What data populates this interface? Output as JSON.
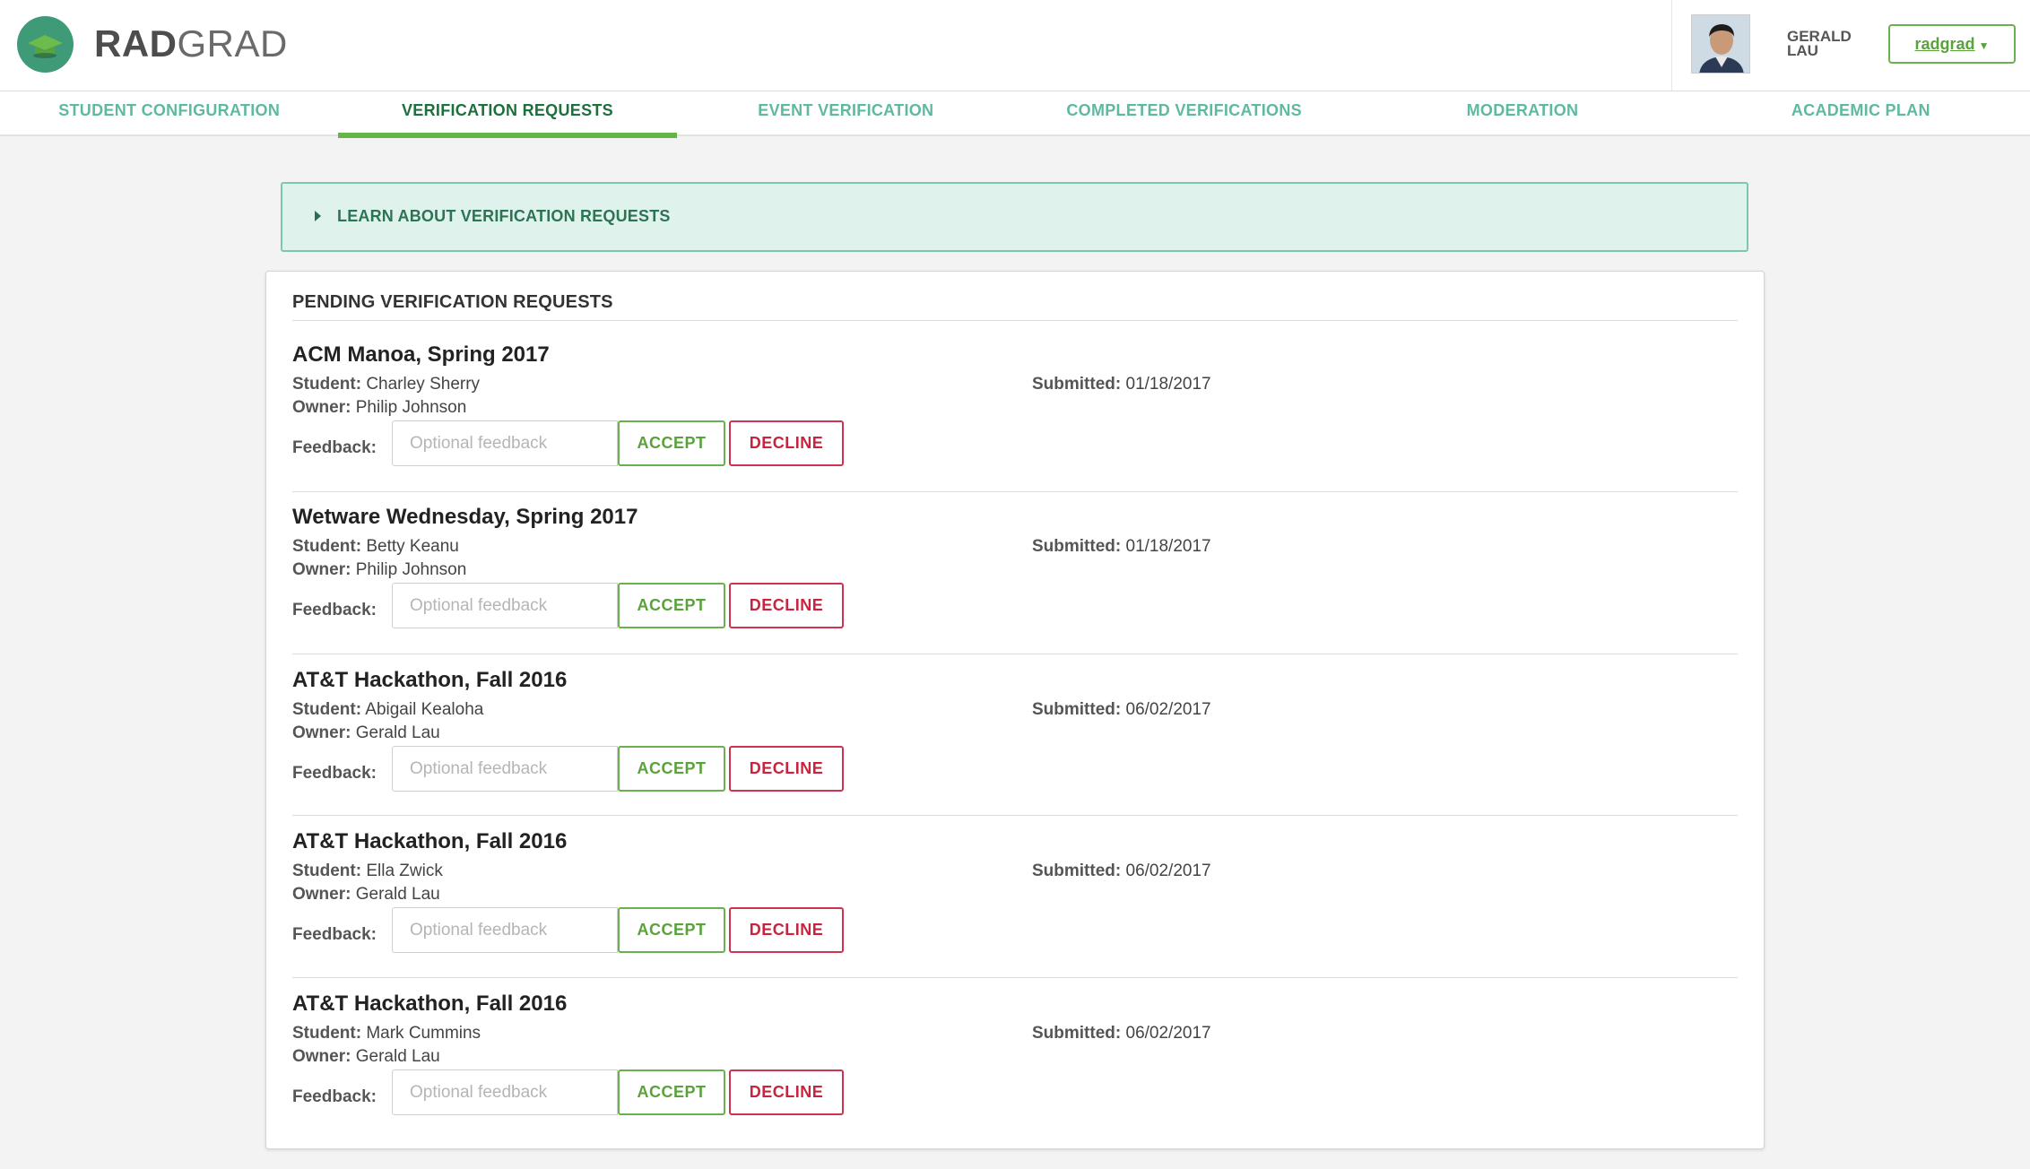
{
  "header": {
    "logo_bold": "RAD",
    "logo_light": "GRAD",
    "user_first": "GERALD",
    "user_last": "LAU",
    "user_menu_label": "radgrad"
  },
  "nav": {
    "tabs": [
      {
        "label": "STUDENT CONFIGURATION",
        "active": false
      },
      {
        "label": "VERIFICATION REQUESTS",
        "active": true
      },
      {
        "label": "EVENT VERIFICATION",
        "active": false
      },
      {
        "label": "COMPLETED VERIFICATIONS",
        "active": false
      },
      {
        "label": "MODERATION",
        "active": false
      },
      {
        "label": "ACADEMIC PLAN",
        "active": false
      }
    ]
  },
  "learn": {
    "label": "LEARN ABOUT VERIFICATION REQUESTS"
  },
  "pending": {
    "title": "PENDING VERIFICATION REQUESTS",
    "student_label": "Student:",
    "owner_label": "Owner:",
    "submitted_label": "Submitted:",
    "feedback_label": "Feedback:",
    "feedback_placeholder": "Optional feedback",
    "accept_label": "ACCEPT",
    "decline_label": "DECLINE",
    "requests": [
      {
        "title": "ACM Manoa, Spring 2017",
        "student": "Charley Sherry",
        "owner": "Philip Johnson",
        "submitted": "01/18/2017"
      },
      {
        "title": "Wetware Wednesday, Spring 2017",
        "student": "Betty Keanu",
        "owner": "Philip Johnson",
        "submitted": "01/18/2017"
      },
      {
        "title": "AT&T Hackathon, Fall 2016",
        "student": "Abigail Kealoha",
        "owner": "Gerald Lau",
        "submitted": "06/02/2017"
      },
      {
        "title": "AT&T Hackathon, Fall 2016",
        "student": "Ella Zwick",
        "owner": "Gerald Lau",
        "submitted": "06/02/2017"
      },
      {
        "title": "AT&T Hackathon, Fall 2016",
        "student": "Mark Cummins",
        "owner": "Gerald Lau",
        "submitted": "06/02/2017"
      }
    ]
  },
  "colors": {
    "accent_green": "#63b545",
    "teal": "#5fb8a0",
    "decline_red": "#c8243f",
    "learn_bg": "#e0f2ec"
  }
}
